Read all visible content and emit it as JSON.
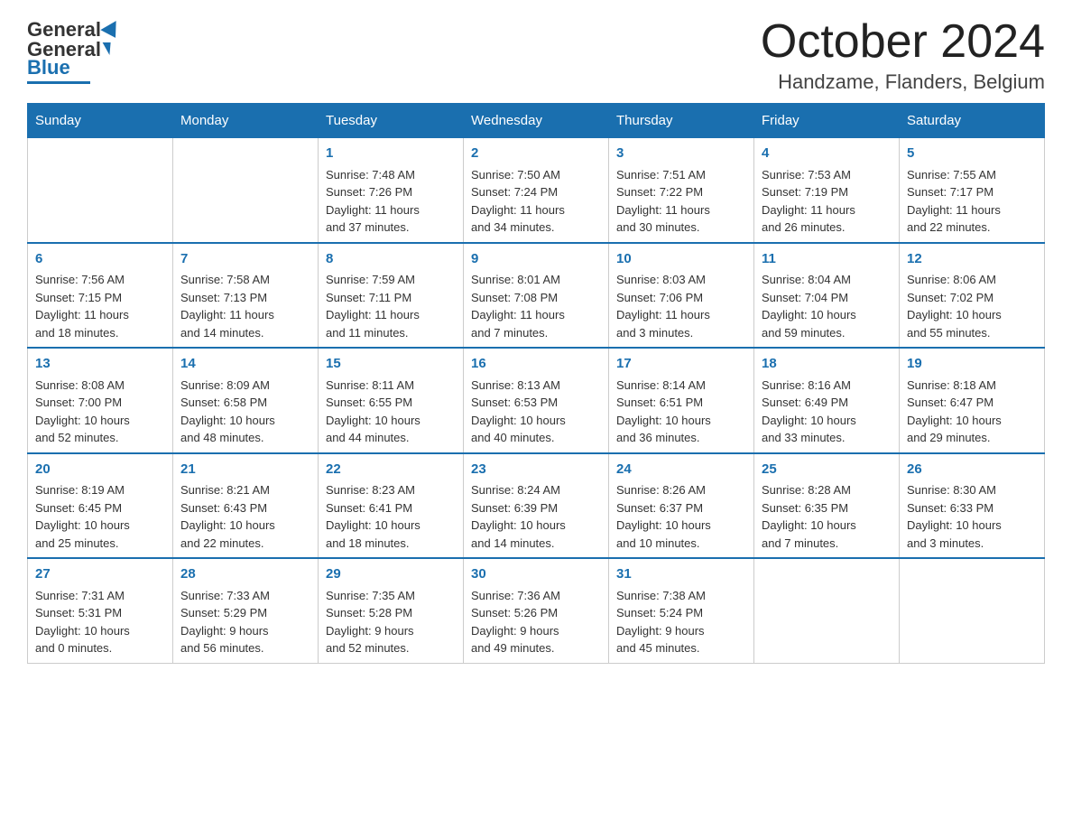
{
  "header": {
    "logo_general": "General",
    "logo_blue": "Blue",
    "month_title": "October 2024",
    "location": "Handzame, Flanders, Belgium"
  },
  "days_of_week": [
    "Sunday",
    "Monday",
    "Tuesday",
    "Wednesday",
    "Thursday",
    "Friday",
    "Saturday"
  ],
  "weeks": [
    [
      {
        "day": "",
        "info": ""
      },
      {
        "day": "",
        "info": ""
      },
      {
        "day": "1",
        "info": "Sunrise: 7:48 AM\nSunset: 7:26 PM\nDaylight: 11 hours\nand 37 minutes."
      },
      {
        "day": "2",
        "info": "Sunrise: 7:50 AM\nSunset: 7:24 PM\nDaylight: 11 hours\nand 34 minutes."
      },
      {
        "day": "3",
        "info": "Sunrise: 7:51 AM\nSunset: 7:22 PM\nDaylight: 11 hours\nand 30 minutes."
      },
      {
        "day": "4",
        "info": "Sunrise: 7:53 AM\nSunset: 7:19 PM\nDaylight: 11 hours\nand 26 minutes."
      },
      {
        "day": "5",
        "info": "Sunrise: 7:55 AM\nSunset: 7:17 PM\nDaylight: 11 hours\nand 22 minutes."
      }
    ],
    [
      {
        "day": "6",
        "info": "Sunrise: 7:56 AM\nSunset: 7:15 PM\nDaylight: 11 hours\nand 18 minutes."
      },
      {
        "day": "7",
        "info": "Sunrise: 7:58 AM\nSunset: 7:13 PM\nDaylight: 11 hours\nand 14 minutes."
      },
      {
        "day": "8",
        "info": "Sunrise: 7:59 AM\nSunset: 7:11 PM\nDaylight: 11 hours\nand 11 minutes."
      },
      {
        "day": "9",
        "info": "Sunrise: 8:01 AM\nSunset: 7:08 PM\nDaylight: 11 hours\nand 7 minutes."
      },
      {
        "day": "10",
        "info": "Sunrise: 8:03 AM\nSunset: 7:06 PM\nDaylight: 11 hours\nand 3 minutes."
      },
      {
        "day": "11",
        "info": "Sunrise: 8:04 AM\nSunset: 7:04 PM\nDaylight: 10 hours\nand 59 minutes."
      },
      {
        "day": "12",
        "info": "Sunrise: 8:06 AM\nSunset: 7:02 PM\nDaylight: 10 hours\nand 55 minutes."
      }
    ],
    [
      {
        "day": "13",
        "info": "Sunrise: 8:08 AM\nSunset: 7:00 PM\nDaylight: 10 hours\nand 52 minutes."
      },
      {
        "day": "14",
        "info": "Sunrise: 8:09 AM\nSunset: 6:58 PM\nDaylight: 10 hours\nand 48 minutes."
      },
      {
        "day": "15",
        "info": "Sunrise: 8:11 AM\nSunset: 6:55 PM\nDaylight: 10 hours\nand 44 minutes."
      },
      {
        "day": "16",
        "info": "Sunrise: 8:13 AM\nSunset: 6:53 PM\nDaylight: 10 hours\nand 40 minutes."
      },
      {
        "day": "17",
        "info": "Sunrise: 8:14 AM\nSunset: 6:51 PM\nDaylight: 10 hours\nand 36 minutes."
      },
      {
        "day": "18",
        "info": "Sunrise: 8:16 AM\nSunset: 6:49 PM\nDaylight: 10 hours\nand 33 minutes."
      },
      {
        "day": "19",
        "info": "Sunrise: 8:18 AM\nSunset: 6:47 PM\nDaylight: 10 hours\nand 29 minutes."
      }
    ],
    [
      {
        "day": "20",
        "info": "Sunrise: 8:19 AM\nSunset: 6:45 PM\nDaylight: 10 hours\nand 25 minutes."
      },
      {
        "day": "21",
        "info": "Sunrise: 8:21 AM\nSunset: 6:43 PM\nDaylight: 10 hours\nand 22 minutes."
      },
      {
        "day": "22",
        "info": "Sunrise: 8:23 AM\nSunset: 6:41 PM\nDaylight: 10 hours\nand 18 minutes."
      },
      {
        "day": "23",
        "info": "Sunrise: 8:24 AM\nSunset: 6:39 PM\nDaylight: 10 hours\nand 14 minutes."
      },
      {
        "day": "24",
        "info": "Sunrise: 8:26 AM\nSunset: 6:37 PM\nDaylight: 10 hours\nand 10 minutes."
      },
      {
        "day": "25",
        "info": "Sunrise: 8:28 AM\nSunset: 6:35 PM\nDaylight: 10 hours\nand 7 minutes."
      },
      {
        "day": "26",
        "info": "Sunrise: 8:30 AM\nSunset: 6:33 PM\nDaylight: 10 hours\nand 3 minutes."
      }
    ],
    [
      {
        "day": "27",
        "info": "Sunrise: 7:31 AM\nSunset: 5:31 PM\nDaylight: 10 hours\nand 0 minutes."
      },
      {
        "day": "28",
        "info": "Sunrise: 7:33 AM\nSunset: 5:29 PM\nDaylight: 9 hours\nand 56 minutes."
      },
      {
        "day": "29",
        "info": "Sunrise: 7:35 AM\nSunset: 5:28 PM\nDaylight: 9 hours\nand 52 minutes."
      },
      {
        "day": "30",
        "info": "Sunrise: 7:36 AM\nSunset: 5:26 PM\nDaylight: 9 hours\nand 49 minutes."
      },
      {
        "day": "31",
        "info": "Sunrise: 7:38 AM\nSunset: 5:24 PM\nDaylight: 9 hours\nand 45 minutes."
      },
      {
        "day": "",
        "info": ""
      },
      {
        "day": "",
        "info": ""
      }
    ]
  ]
}
